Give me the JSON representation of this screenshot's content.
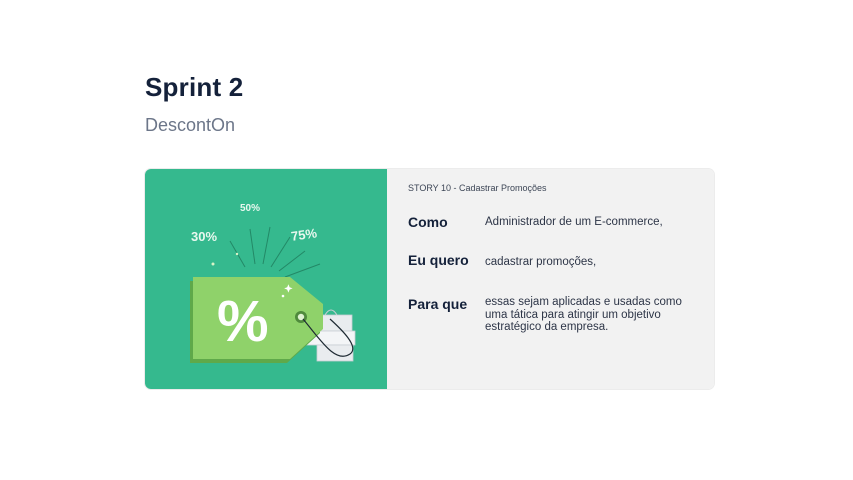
{
  "header": {
    "title": "Sprint 2",
    "subtitle": "DescontOn"
  },
  "illustration": {
    "badge_30": "30%",
    "badge_50": "50%",
    "badge_75": "75%",
    "tag_symbol": "%",
    "bg_color": "#35b98e",
    "tag_color": "#8fd26a"
  },
  "story": {
    "label": "STORY 10 - Cadastrar Promoções",
    "rows": [
      {
        "key": "Como",
        "value": "Administrador de um E-commerce,"
      },
      {
        "key": "Eu quero",
        "value": "cadastrar promoções,"
      },
      {
        "key": "Para que",
        "value": "essas sejam aplicadas e usadas como uma tática para atingir um objetivo estratégico da empresa."
      }
    ]
  }
}
